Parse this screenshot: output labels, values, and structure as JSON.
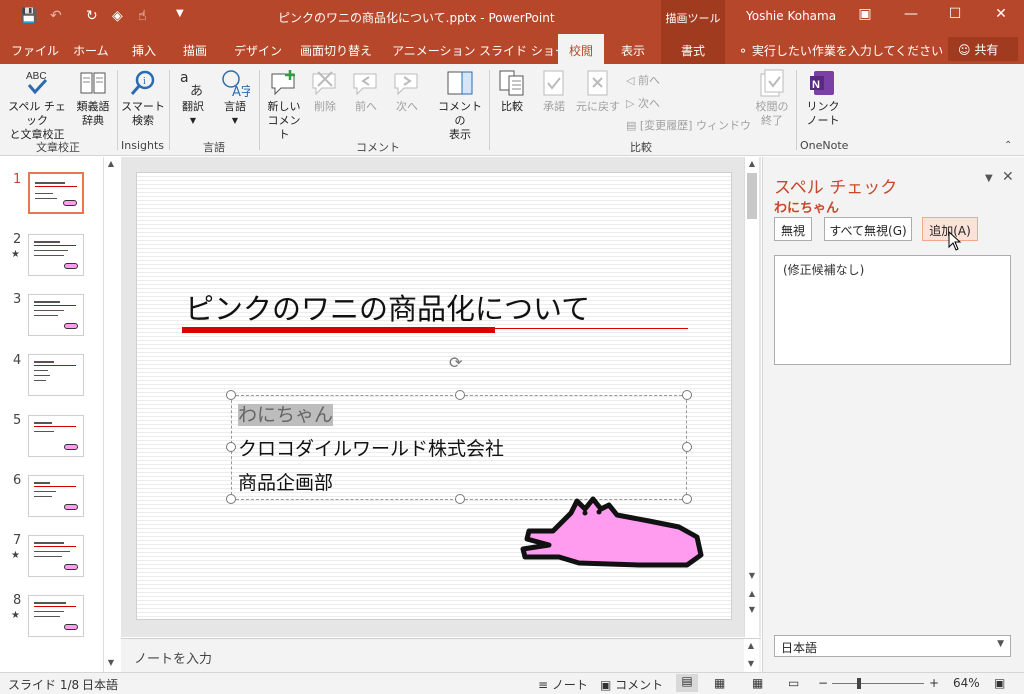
{
  "window": {
    "title": "ピンクのワニの商品化について.pptx - PowerPoint",
    "context_tools": "描画ツール",
    "user": "Yoshie Kohama"
  },
  "tabs": [
    "ファイル",
    "ホーム",
    "挿入",
    "描画",
    "デザイン",
    "画面切り替え",
    "アニメーション",
    "スライド ショー",
    "校閲",
    "表示"
  ],
  "format_tab": "書式",
  "tell_me": "実行したい作業を入力してください",
  "share": "共有",
  "ribbon": {
    "spell": [
      "スペル チェック",
      "と文章校正"
    ],
    "thesaurus": [
      "類義語",
      "辞典"
    ],
    "smart": [
      "スマート",
      "検索"
    ],
    "translate": "翻訳",
    "language": "言語",
    "new_comment": [
      "新しい",
      "コメント"
    ],
    "delete": "削除",
    "prev": "前へ",
    "next": "次へ",
    "show_comments": [
      "コメントの",
      "表示"
    ],
    "compare": "比較",
    "accept": "承諾",
    "reject": "元に戻す",
    "cmp_prev": "前へ",
    "cmp_next": "次へ",
    "history": "[変更履歴] ウィンドウ",
    "end_review": [
      "校閲の",
      "終了"
    ],
    "link_notes": [
      "リンク",
      "ノート"
    ],
    "groups": [
      "文章校正",
      "Insights",
      "言語",
      "コメント",
      "比較",
      "OneNote"
    ]
  },
  "thumbnails": [
    {
      "num": "1",
      "star": ""
    },
    {
      "num": "2",
      "star": "★"
    },
    {
      "num": "3",
      "star": ""
    },
    {
      "num": "4",
      "star": ""
    },
    {
      "num": "5",
      "star": ""
    },
    {
      "num": "6",
      "star": ""
    },
    {
      "num": "7",
      "star": "★"
    },
    {
      "num": "8",
      "star": "★"
    }
  ],
  "slide": {
    "title": "ピンクのワニの商品化について",
    "lines": [
      "わにちゃん",
      "クロコダイルワールド株式会社",
      "商品企画部"
    ]
  },
  "notes_placeholder": "ノートを入力",
  "spell_pane": {
    "title": "スペル チェック",
    "word": "わにちゃん",
    "ignore": "無視",
    "ignore_all": "すべて無視(G)",
    "add": "追加(A)",
    "suggestion": "(修正候補なし)",
    "language": "日本語"
  },
  "status": {
    "slide": "スライド 1/8",
    "language": "日本語",
    "notes": "ノート",
    "comments": "コメント",
    "zoom": "64%"
  },
  "colors": {
    "accent": "#b7472a",
    "pink_croc": "#ff9cf0"
  }
}
